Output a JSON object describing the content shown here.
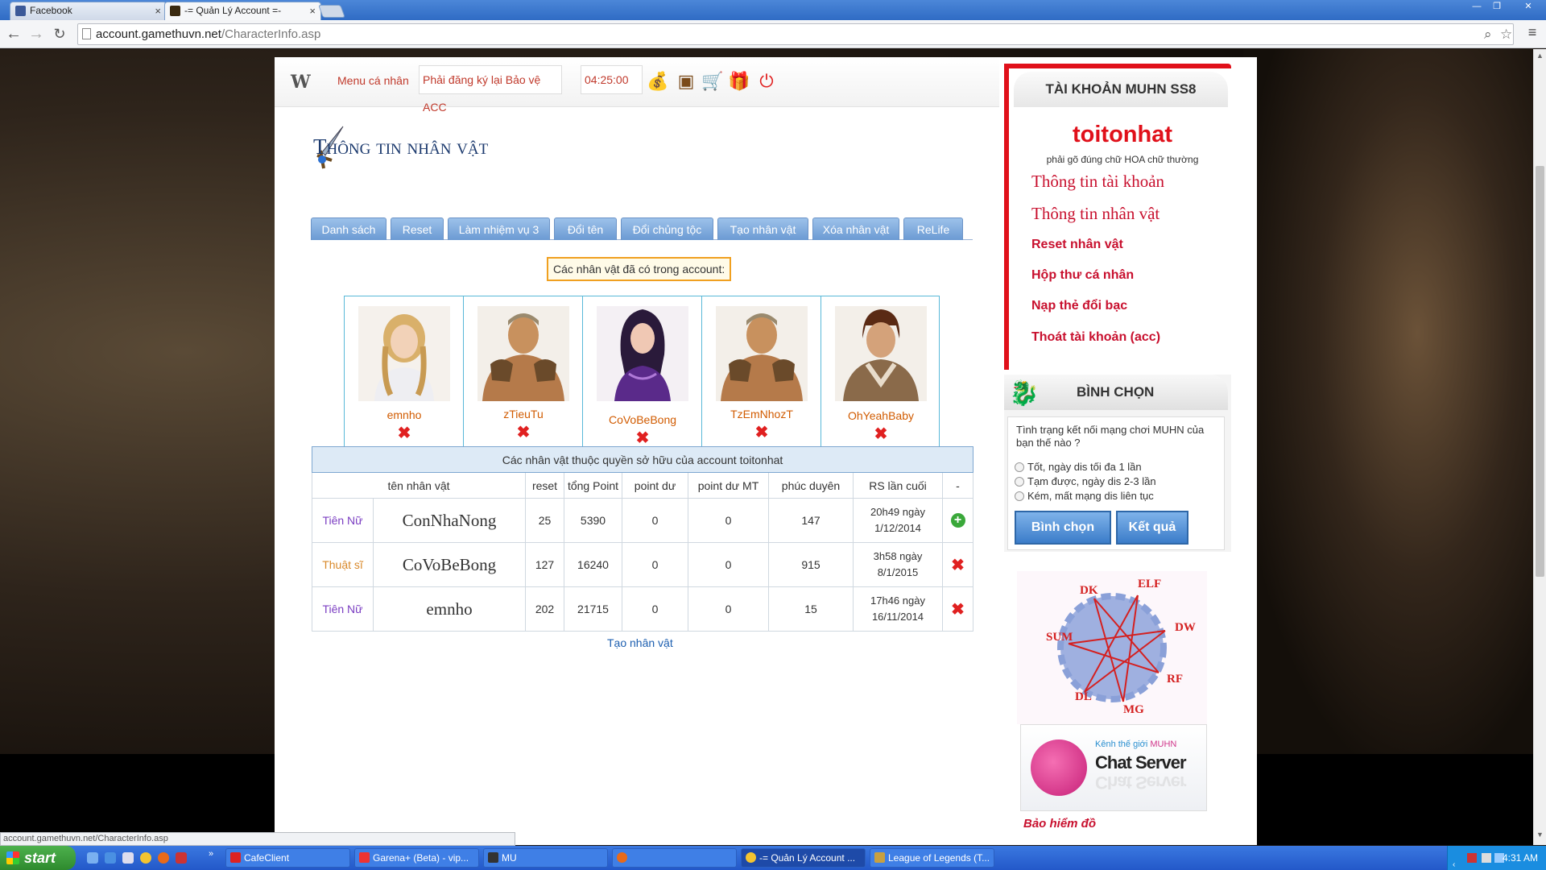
{
  "browser": {
    "tabs": [
      {
        "label": "Facebook",
        "active": false
      },
      {
        "label": "-= Quản Lý Account =-",
        "active": true
      }
    ],
    "url_host": "account.gamethuvn.net",
    "url_path": "/CharacterInfo.asp",
    "status_url": "account.gamethuvn.net/CharacterInfo.asp"
  },
  "topbar": {
    "logo": "W",
    "menu_label": "Menu cá nhân",
    "notice": "Phải đăng ký lại Bảo vệ ACC",
    "time": "04:25:00",
    "icons": [
      "money-bag-icon",
      "treasure-chest-icon",
      "shopping-cart-icon",
      "gift-icon",
      "power-icon"
    ]
  },
  "content": {
    "title": "Thông tin nhân vật",
    "tabs": [
      "Danh sách",
      "Reset",
      "Làm nhiệm vụ 3",
      "Đổi tên",
      "Đổi chủng tộc",
      "Tạo nhân vật",
      "Xóa nhân vật",
      "ReLife"
    ],
    "chars_caption": "Các nhân vật đã có trong account:",
    "characters": [
      {
        "name": "emnho"
      },
      {
        "name": "zTieuTu"
      },
      {
        "name": "CoVoBeBong"
      },
      {
        "name": "TzEmNhozT"
      },
      {
        "name": "OhYeahBaby"
      }
    ],
    "owned": {
      "caption": "Các nhân vật thuộc quyền sở hữu của account toitonhat",
      "headers": [
        "tên nhân vật",
        "reset",
        "tổng Point",
        "point dư",
        "point dư MT",
        "phúc duyên",
        "RS lần cuối",
        "-"
      ],
      "rows": [
        {
          "class": "Tiên Nữ",
          "name": "ConNhaNong",
          "reset": "25",
          "total_point": "5390",
          "point_du": "0",
          "point_du_mt": "0",
          "phuc_duyen": "147",
          "rs_time": "20h49 ngày",
          "rs_date": "1/12/2014",
          "action": "add"
        },
        {
          "class": "Thuật sĩ",
          "name": "CoVoBeBong",
          "reset": "127",
          "total_point": "16240",
          "point_du": "0",
          "point_du_mt": "0",
          "phuc_duyen": "915",
          "rs_time": "3h58 ngày",
          "rs_date": "8/1/2015",
          "action": "delete"
        },
        {
          "class": "Tiên Nữ",
          "name": "emnho",
          "reset": "202",
          "total_point": "21715",
          "point_du": "0",
          "point_du_mt": "0",
          "phuc_duyen": "15",
          "rs_time": "17h46 ngày",
          "rs_date": "16/11/2014",
          "action": "delete"
        }
      ]
    },
    "create_link": "Tạo nhân vật"
  },
  "sidebar": {
    "account_header": "TÀI KHOẢN MUHN SS8",
    "username": "toitonhat",
    "note": "phải gõ đúng chữ HOA chữ thường",
    "links": [
      "Thông tin tài khoản",
      "Thông tin nhân vật",
      "Reset nhân vật",
      "Hộp thư cá nhân",
      "Nạp thẻ đổi bạc",
      "Thoát tài khoản (acc)"
    ],
    "vote": {
      "title": "BÌNH CHỌN",
      "question": "Tình trạng kết nối mạng chơi MUHN của bạn thế nào ?",
      "options": [
        "Tốt, ngày dis tối đa 1 lần",
        "Tạm được, ngày dis 2-3 lần",
        "Kém, mất mạng dis liên tục"
      ],
      "vote_button": "Bình chọn",
      "result_button": "Kết quả"
    },
    "class_diagram": [
      "DK",
      "ELF",
      "DW",
      "RF",
      "MG",
      "DL",
      "SUM"
    ],
    "chat_banner": {
      "channel_prefix": "Kênh thế giới",
      "channel_brand": "MUHN",
      "title": "Chat Server"
    },
    "insurance": "Bảo hiểm đồ"
  },
  "taskbar": {
    "start": "start",
    "tasks": [
      {
        "label": "CafeClient",
        "active": false
      },
      {
        "label": "Garena+ (Beta) - vip...",
        "active": false
      },
      {
        "label": "MU",
        "active": false
      },
      {
        "label": "",
        "active": false
      },
      {
        "label": "-= Quản Lý Account ...",
        "active": true
      },
      {
        "label": "League of Legends (T...",
        "active": false
      }
    ],
    "clock": "4:31 AM"
  }
}
